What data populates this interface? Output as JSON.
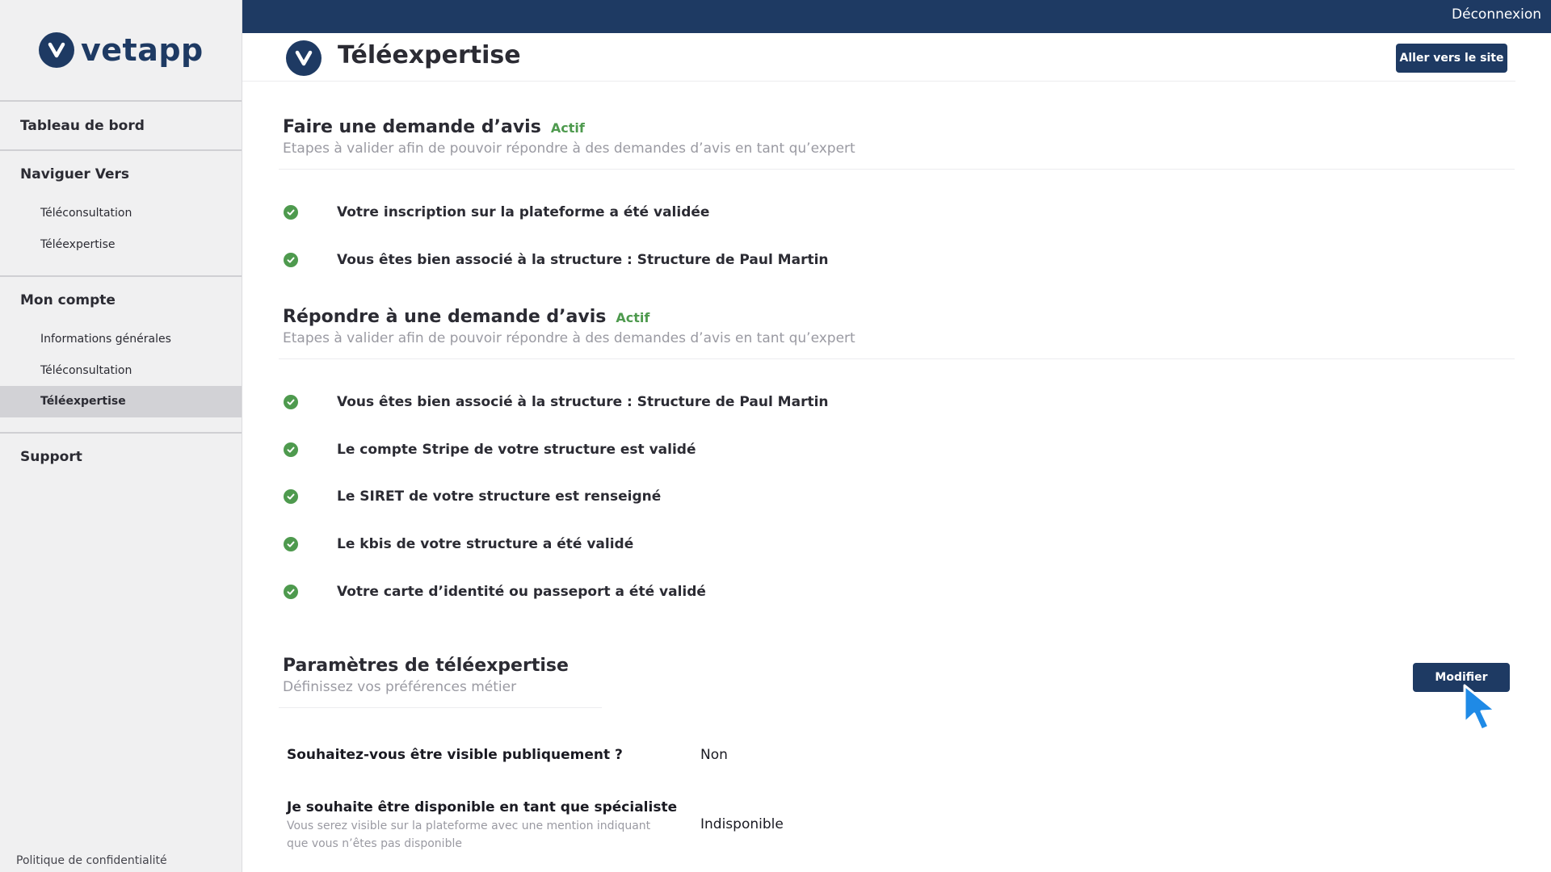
{
  "sidebar": {
    "logo_text": "vetapp",
    "dashboard": "Tableau de bord",
    "navigate_title": "Naviguer Vers",
    "navigate_items": [
      "Téléconsultation",
      "Téléexpertise"
    ],
    "account_title": "Mon compte",
    "account_items": [
      "Informations générales",
      "Téléconsultation",
      "Téléexpertise"
    ],
    "active_item": "Téléexpertise",
    "support": "Support",
    "privacy": "Politique de confidentialité"
  },
  "topbar": {
    "logout": "Déconnexion"
  },
  "header": {
    "title": "Téléexpertise",
    "site_button": "Aller vers le site"
  },
  "section1": {
    "title": "Faire une demande d’avis",
    "badge": "Actif",
    "subtitle": "Etapes à valider afin de pouvoir répondre à des demandes d’avis en tant qu’expert",
    "items": [
      "Votre inscription sur la plateforme a été validée",
      "Vous êtes bien associé à la structure : Structure de Paul Martin"
    ]
  },
  "section2": {
    "title": "Répondre à une demande d’avis",
    "badge": "Actif",
    "subtitle": "Etapes à valider afin de pouvoir répondre à des demandes d’avis en tant qu’expert",
    "items": [
      "Vous êtes bien associé à la structure : Structure de Paul Martin",
      "Le compte Stripe de votre structure est validé",
      "Le SIRET de votre structure est renseigné",
      "Le kbis de votre structure a été validé",
      "Votre carte d’identité ou passeport a été validé"
    ]
  },
  "params": {
    "title": "Paramètres de téléexpertise",
    "subtitle": "Définissez vos préférences métier",
    "modify_button": "Modifier",
    "rows": [
      {
        "label": "Souhaitez-vous être visible publiquement ?",
        "value": "Non"
      },
      {
        "label": "Je souhaite être disponible en tant que spécialiste",
        "description": "Vous serez visible sur la plateforme avec une mention indiquant que vous n’êtes pas disponible",
        "value": "Indisponible"
      }
    ]
  },
  "colors": {
    "primary": "#1e3a63",
    "success": "#4e9a4e",
    "cursor": "#1f8ae6"
  },
  "icons": {
    "logo": "v-logo-icon",
    "check": "check-circle-icon",
    "cursor": "mouse-pointer-icon"
  }
}
